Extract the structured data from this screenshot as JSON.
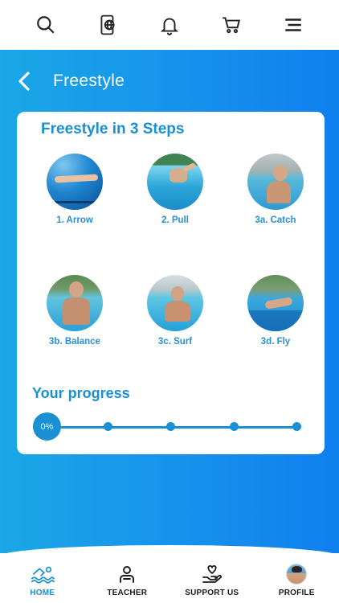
{
  "topbar": {
    "icons": [
      "search-icon",
      "phone-globe-icon",
      "bell-icon",
      "cart-icon",
      "menu-icon"
    ]
  },
  "header": {
    "title": "Freestyle"
  },
  "card": {
    "title": "Freestyle in 3 Steps",
    "steps": [
      {
        "label": "1. Arrow"
      },
      {
        "label": "2. Pull"
      },
      {
        "label": "3a. Catch"
      },
      {
        "label": "3b. Balance"
      },
      {
        "label": "3c. Surf"
      },
      {
        "label": "3d. Fly"
      }
    ]
  },
  "progress": {
    "title": "Your progress",
    "value_label": "0%",
    "value": 0,
    "milestones": 6
  },
  "bottom_nav": {
    "items": [
      {
        "label": "HOME",
        "icon": "swimmer-icon",
        "active": true
      },
      {
        "label": "TEACHER",
        "icon": "teacher-icon",
        "active": false
      },
      {
        "label": "SUPPORT US",
        "icon": "heart-hand-icon",
        "active": false
      },
      {
        "label": "PROFILE",
        "icon": "avatar",
        "active": false
      }
    ]
  },
  "colors": {
    "accent": "#1a8fd4",
    "gradient_start": "#1aa7e6",
    "gradient_end": "#0f7fee"
  }
}
